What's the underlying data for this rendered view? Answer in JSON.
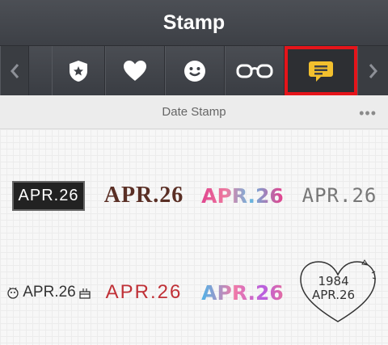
{
  "header": {
    "title": "Stamp"
  },
  "tabs": [
    {
      "icon": "shield-star-icon"
    },
    {
      "icon": "heart-icon"
    },
    {
      "icon": "smiley-icon"
    },
    {
      "icon": "glasses-icon"
    },
    {
      "icon": "speech-bubble-icon",
      "selected": true
    }
  ],
  "section": {
    "title": "Date Stamp",
    "more": "•••"
  },
  "stamps": [
    {
      "text": "APR.26"
    },
    {
      "text": "APR.26"
    },
    {
      "text": "APR.26"
    },
    {
      "text": "APR.26"
    },
    {
      "text": "APR.26"
    },
    {
      "text": "APR.26"
    },
    {
      "text": "APR.26"
    },
    {
      "line1": "1984",
      "line2": "APR.26"
    }
  ],
  "colors": {
    "highlight": "#e5141a",
    "bubble": "#f2c02e"
  }
}
